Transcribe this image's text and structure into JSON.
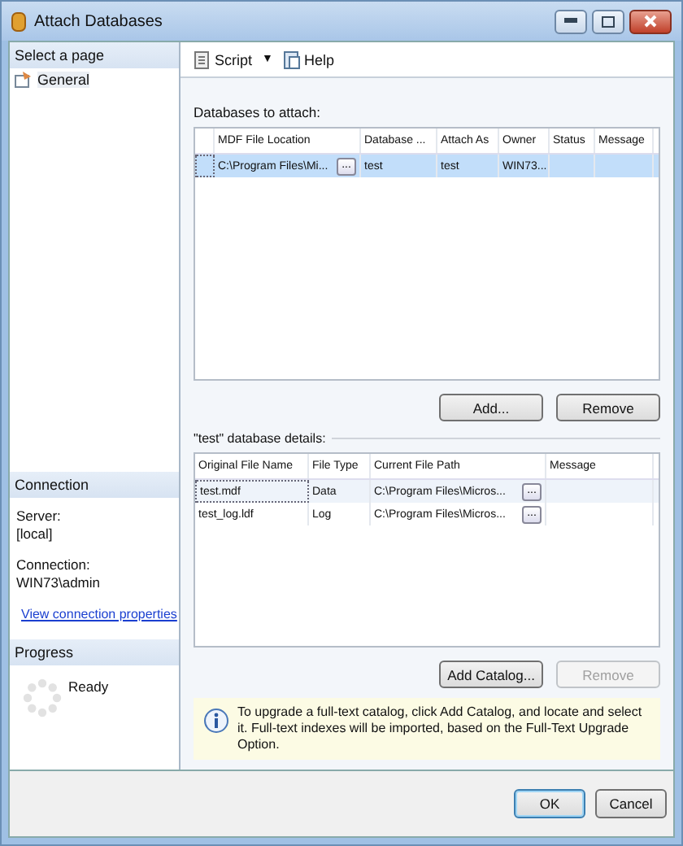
{
  "window": {
    "title": "Attach Databases"
  },
  "sidebar": {
    "header": "Select a page",
    "pages": [
      {
        "label": "General",
        "selected": true
      }
    ]
  },
  "connection": {
    "header": "Connection",
    "server_label": "Server:",
    "server": "[local]",
    "connection_label": "Connection:",
    "connection": "WIN73\\admin",
    "link": "View connection properties"
  },
  "progress": {
    "header": "Progress",
    "status": "Ready"
  },
  "toolbar": {
    "script": "Script",
    "caret": "▼",
    "help": "Help"
  },
  "attach": {
    "label": "Databases to attach:",
    "columns": [
      "MDF File Location",
      "Database ...",
      "Attach As",
      "Owner",
      "Status",
      "Message"
    ],
    "rows": [
      {
        "selected": true,
        "cells": [
          "C:\\Program Files\\Mi...",
          "test",
          "test",
          "WIN73...",
          "",
          ""
        ],
        "browse": "..."
      }
    ],
    "buttons": [
      {
        "label": "Add...",
        "disabled": false
      },
      {
        "label": "Remove",
        "disabled": false
      }
    ]
  },
  "details": {
    "label": "\"test\" database details:",
    "columns": [
      "Original File Name",
      "File Type",
      "Current File Path",
      "Message"
    ],
    "rows": [
      {
        "selected": true,
        "cells": [
          "test.mdf",
          "Data",
          "C:\\Program Files\\Micros...",
          ""
        ],
        "browse": "..."
      },
      {
        "selected": false,
        "cells": [
          "test_log.ldf",
          "Log",
          "C:\\Program Files\\Micros...",
          ""
        ],
        "browse": "..."
      }
    ],
    "buttons": [
      {
        "label": "Add Catalog...",
        "disabled": false
      },
      {
        "label": "Remove",
        "disabled": true
      }
    ]
  },
  "info": "To upgrade a full-text catalog, click Add Catalog, and locate and select it. Full-text indexes will be imported, based on the Full-Text Upgrade Option.",
  "footer": {
    "buttons": [
      {
        "label": "OK",
        "disabled": false
      },
      {
        "label": "Cancel",
        "disabled": false
      }
    ]
  }
}
